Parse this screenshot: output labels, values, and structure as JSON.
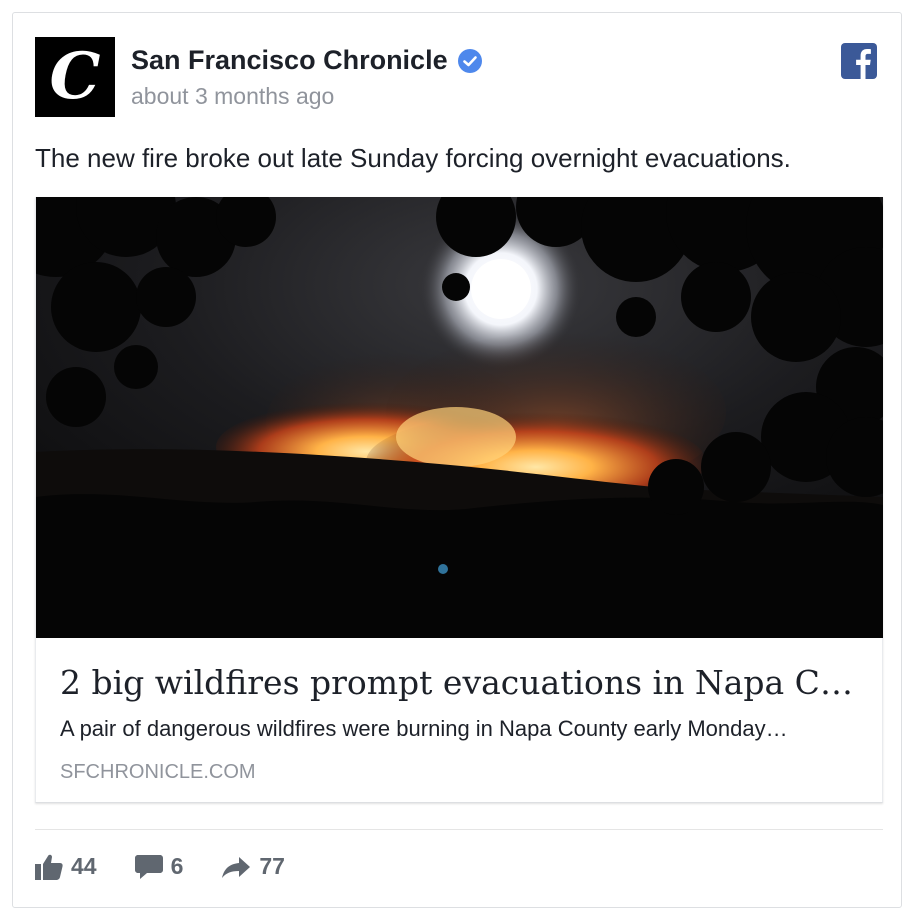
{
  "post": {
    "page_name": "San Francisco Chronicle",
    "avatar_letter": "C",
    "timestamp": "about 3 months ago",
    "text": "The new fire broke out late Sunday forcing overnight evacuations.",
    "icons": {
      "verified": "verified-badge-icon",
      "facebook": "facebook-logo-icon"
    }
  },
  "link": {
    "image_description": "wildfire-night-photo",
    "title": "2 big wildfires prompt evacuations in Napa Cou…",
    "description": "A pair of dangerous wildfires were burning in Napa County early Monday…",
    "domain": "SFCHRONICLE.COM"
  },
  "actions": {
    "likes": "44",
    "comments": "6",
    "shares": "77"
  },
  "colors": {
    "verified_blue": "#4e88ec",
    "facebook_blue": "#3b5998",
    "muted_text": "#90949c",
    "action_gray": "#606770"
  }
}
